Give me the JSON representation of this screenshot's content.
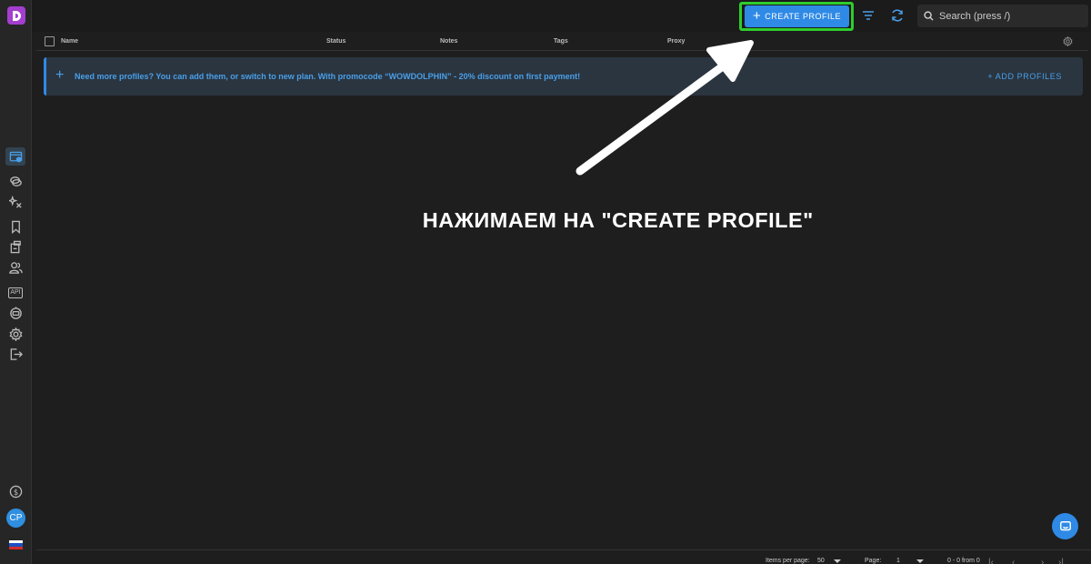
{
  "topbar": {
    "create_button": "CREATE PROFILE",
    "search_placeholder": "Search (press /)"
  },
  "table": {
    "columns": [
      "Name",
      "Status",
      "Notes",
      "Tags",
      "Proxy"
    ]
  },
  "banner": {
    "text": "Need more profiles? You can add them, or switch to new plan. With promocode “WOWDOLPHIN” - 20% discount on first payment!",
    "action": "+ ADD PROFILES"
  },
  "annotation": {
    "text": "НАЖИМАЕМ НА \"CREATE PROFILE\""
  },
  "user": {
    "initials": "CP"
  },
  "pagination": {
    "items_per_page_label": "Items per page:",
    "items_per_page_value": "50",
    "page_label": "Page:",
    "page_value": "1",
    "range": "0 - 0 from 0"
  },
  "colors": {
    "accent": "#2f8ae6",
    "highlight": "#2ecc2e",
    "logo": "#a33ecf"
  },
  "icons": [
    "logo-icon",
    "profiles-icon",
    "chat-bubbles-icon",
    "magic-icon",
    "bookmark-icon",
    "clipboard-icon",
    "users-icon",
    "api-icon",
    "bot-icon",
    "settings-icon",
    "logout-icon",
    "dollar-icon",
    "filter-icon",
    "refresh-icon",
    "search-icon",
    "gear-icon",
    "chat-icon"
  ]
}
